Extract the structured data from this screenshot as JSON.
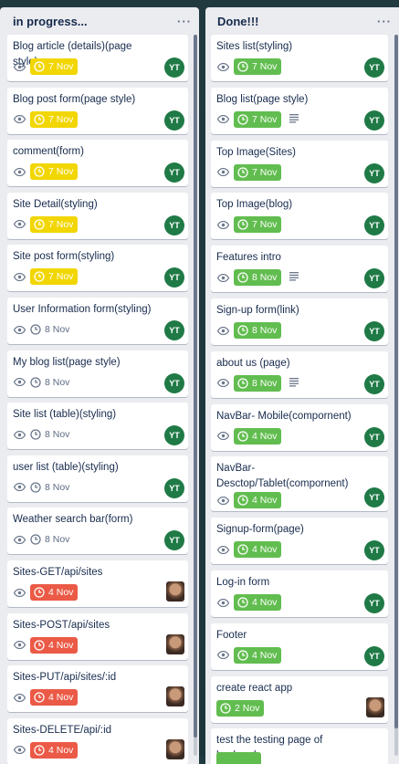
{
  "lists": [
    {
      "title": "in progress...",
      "menu": "···",
      "cards": [
        {
          "title": "Blog article (details)(page style)",
          "date": "7 Nov",
          "status": "yellow",
          "avatar": "YT"
        },
        {
          "title": "Blog post form(page style)",
          "date": "7 Nov",
          "status": "yellow",
          "avatar": "YT"
        },
        {
          "title": "comment(form)",
          "date": "7 Nov",
          "status": "yellow",
          "avatar": "YT"
        },
        {
          "title": "Site Detail(styling)",
          "date": "7 Nov",
          "status": "yellow",
          "avatar": "YT"
        },
        {
          "title": "Site post form(styling)",
          "date": "7 Nov",
          "status": "yellow",
          "avatar": "YT"
        },
        {
          "title": "User Information form(styling)",
          "date": "8 Nov",
          "status": "plain",
          "avatar": "YT"
        },
        {
          "title": "My blog list(page style)",
          "date": "8 Nov",
          "status": "plain",
          "avatar": "YT"
        },
        {
          "title": "Site list (table)(styling)",
          "date": "8 Nov",
          "status": "plain",
          "avatar": "YT"
        },
        {
          "title": "user list (table)(styling)",
          "date": "8 Nov",
          "status": "plain",
          "avatar": "YT"
        },
        {
          "title": "Weather search bar(form)",
          "date": "8 Nov",
          "status": "plain",
          "avatar": "YT"
        },
        {
          "title": "Sites-GET/api/sites",
          "date": "4 Nov",
          "status": "red",
          "avatar": "photo"
        },
        {
          "title": "Sites-POST/api/sites",
          "date": "4 Nov",
          "status": "red",
          "avatar": "photo"
        },
        {
          "title": "Sites-PUT/api/sites/:id",
          "date": "4 Nov",
          "status": "red",
          "avatar": "photo"
        },
        {
          "title": "Sites-DELETE/api/:id",
          "date": "4 Nov",
          "status": "red",
          "avatar": "photo"
        }
      ]
    },
    {
      "title": "Done!!!",
      "menu": "···",
      "cards": [
        {
          "title": "Sites list(styling)",
          "date": "7 Nov",
          "status": "green",
          "avatar": "YT"
        },
        {
          "title": "Blog list(page style)",
          "date": "7 Nov",
          "status": "green",
          "avatar": "YT",
          "desc": true
        },
        {
          "title": "Top Image(Sites)",
          "date": "7 Nov",
          "status": "green",
          "avatar": "YT"
        },
        {
          "title": "Top Image(blog)",
          "date": "7 Nov",
          "status": "green",
          "avatar": "YT"
        },
        {
          "title": "Features intro",
          "date": "8 Nov",
          "status": "green",
          "avatar": "YT",
          "desc": true
        },
        {
          "title": "Sign-up form(link)",
          "date": "8 Nov",
          "status": "green",
          "avatar": "YT"
        },
        {
          "title": "about us (page)",
          "date": "8 Nov",
          "status": "green",
          "avatar": "YT",
          "desc": true
        },
        {
          "title": "NavBar- Mobile(compornent)",
          "date": "4 Nov",
          "status": "green",
          "avatar": "YT"
        },
        {
          "title": "NavBar-Desctop/Tablet(compornent)",
          "date": "4 Nov",
          "status": "green",
          "avatar": "YT",
          "twoLine": true
        },
        {
          "title": "Signup-form(page)",
          "date": "4 Nov",
          "status": "green",
          "avatar": "YT"
        },
        {
          "title": "Log-in form",
          "date": "4 Nov",
          "status": "green",
          "avatar": "YT"
        },
        {
          "title": "Footer",
          "date": "4 Nov",
          "status": "green",
          "avatar": "YT"
        },
        {
          "title": "create react app",
          "date": "2 Nov",
          "status": "green",
          "avatar": "photo",
          "noEye": true
        },
        {
          "title": "test the testing page of backend",
          "date": "",
          "status": "green",
          "avatar": "",
          "noEye": true
        }
      ]
    }
  ],
  "colors": {
    "yellow": "#f2d600",
    "green": "#61bd4f",
    "red": "#eb5a46",
    "avatar": "#1f7a46"
  },
  "icons": {
    "watch": "eye-icon",
    "due": "clock-icon",
    "description": "description-icon",
    "menu": "more-icon"
  }
}
